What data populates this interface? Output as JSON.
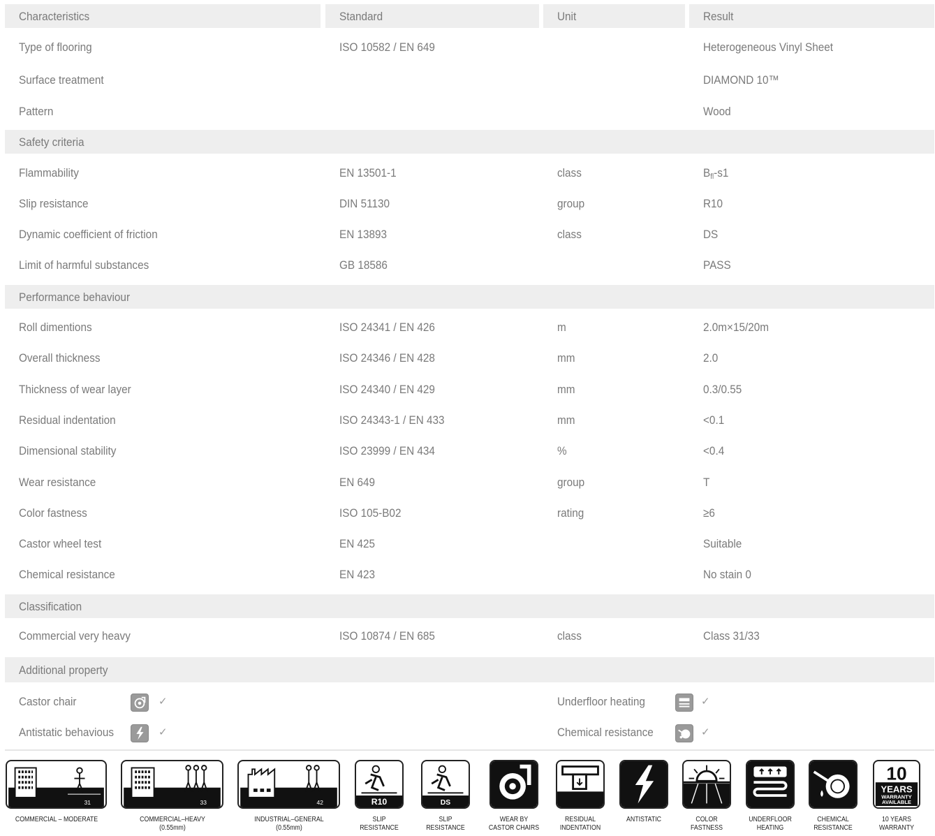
{
  "header": {
    "c1": "Characteristics",
    "c2": "Standard",
    "c3": "Unit",
    "c4": "Result"
  },
  "general": [
    {
      "name": "Type of flooring",
      "standard": "ISO 10582 / EN 649",
      "unit": "",
      "result": "Heterogeneous Vinyl Sheet"
    },
    {
      "name": "Surface treatment",
      "standard": "",
      "unit": "",
      "result": "DIAMOND 10™"
    },
    {
      "name": "Pattern",
      "standard": "",
      "unit": "",
      "result": "Wood"
    }
  ],
  "safety": {
    "title": "Safety criteria",
    "rows": [
      {
        "name": "Flammability",
        "standard": "EN 13501-1",
        "unit": "class",
        "result_main": "B",
        "result_sub": "fl",
        "result_tail": "-s1"
      },
      {
        "name": "Slip resistance",
        "standard": "DIN 51130",
        "unit": "group",
        "result": "R10"
      },
      {
        "name": "Dynamic coefficient of friction",
        "standard": "EN 13893",
        "unit": "class",
        "result": "DS"
      },
      {
        "name": "Limit of harmful substances",
        "standard": "GB 18586",
        "unit": "",
        "result": "PASS"
      }
    ]
  },
  "performance": {
    "title": "Performance behaviour",
    "rows": [
      {
        "name": "Roll dimentions",
        "standard": "ISO 24341 / EN 426",
        "unit": "m",
        "result": "2.0m×15/20m"
      },
      {
        "name": "Overall thickness",
        "standard": "ISO 24346 / EN 428",
        "unit": "mm",
        "result": "2.0"
      },
      {
        "name": "Thickness of wear layer",
        "standard": "ISO 24340 / EN 429",
        "unit": "mm",
        "result": "0.3/0.55"
      },
      {
        "name": "Residual indentation",
        "standard": "ISO 24343-1 / EN 433",
        "unit": "mm",
        "result": "<0.1"
      },
      {
        "name": "Dimensional stability",
        "standard": "ISO 23999 / EN 434",
        "unit": "%",
        "result": "<0.4"
      },
      {
        "name": "Wear resistance",
        "standard": "EN 649",
        "unit": "group",
        "result": "T"
      },
      {
        "name": "Color fastness",
        "standard": "ISO 105-B02",
        "unit": "rating",
        "result": "≥6"
      },
      {
        "name": "Castor wheel test",
        "standard": "EN 425",
        "unit": "",
        "result": "Suitable"
      },
      {
        "name": "Chemical resistance",
        "standard": "EN 423",
        "unit": "",
        "result": "No stain 0"
      }
    ]
  },
  "classification": {
    "title": "Classification",
    "rows": [
      {
        "name": "Commercial very heavy",
        "standard": "ISO 10874 / EN 685",
        "unit": "class",
        "result": "Class 31/33"
      }
    ]
  },
  "additional": {
    "title": "Additional property",
    "items": [
      {
        "label": "Castor chair",
        "icon": "castor-chair-icon",
        "check": "✓"
      },
      {
        "label": "Underfloor heating",
        "icon": "underfloor-heating-icon",
        "check": "✓"
      },
      {
        "label": "Antistatic behavious",
        "icon": "antistatic-icon",
        "check": "✓"
      },
      {
        "label": "Chemical resistance",
        "icon": "chemical-resistance-icon",
        "check": "✓"
      }
    ]
  },
  "badges": [
    {
      "icon": "commercial-moderate-icon",
      "code": "31",
      "caption_1": "COMMERCIAL – MODERATE",
      "caption_2": ""
    },
    {
      "icon": "commercial-heavy-icon",
      "code": "33",
      "caption_1": "COMMERCIAL–HEAVY",
      "caption_2": "(0.55mm)"
    },
    {
      "icon": "industrial-general-icon",
      "code": "42",
      "caption_1": "INDUSTRIAL–GENERAL",
      "caption_2": "(0.55mm)"
    },
    {
      "icon": "slip-resistance-r10-icon",
      "code": "R10",
      "caption_1": "SLIP",
      "caption_2": "RESISTANCE"
    },
    {
      "icon": "slip-resistance-ds-icon",
      "code": "DS",
      "caption_1": "SLIP",
      "caption_2": "RESISTANCE"
    },
    {
      "icon": "castor-chair-icon",
      "code": "",
      "caption_1": "WEAR BY",
      "caption_2": "CASTOR CHAIRS"
    },
    {
      "icon": "residual-indentation-icon",
      "code": "",
      "caption_1": "RESIDUAL",
      "caption_2": "INDENTATION"
    },
    {
      "icon": "antistatic-icon",
      "code": "",
      "caption_1": "ANTISTATIC",
      "caption_2": ""
    },
    {
      "icon": "color-fastness-icon",
      "code": "",
      "caption_1": "COLOR",
      "caption_2": "FASTNESS"
    },
    {
      "icon": "underfloor-heating-icon",
      "code": "",
      "caption_1": "UNDERFLOOR",
      "caption_2": "HEATING"
    },
    {
      "icon": "chemical-resistance-icon",
      "code": "",
      "caption_1": "CHEMICAL",
      "caption_2": "RESISTANCE"
    },
    {
      "icon": "warranty-icon",
      "code": "10",
      "code_2": "YEARS",
      "code_3": "WARRANTY",
      "code_4": "AVAILABLE",
      "caption_1": "10 YEARS",
      "caption_2": "WARRANTY"
    }
  ]
}
